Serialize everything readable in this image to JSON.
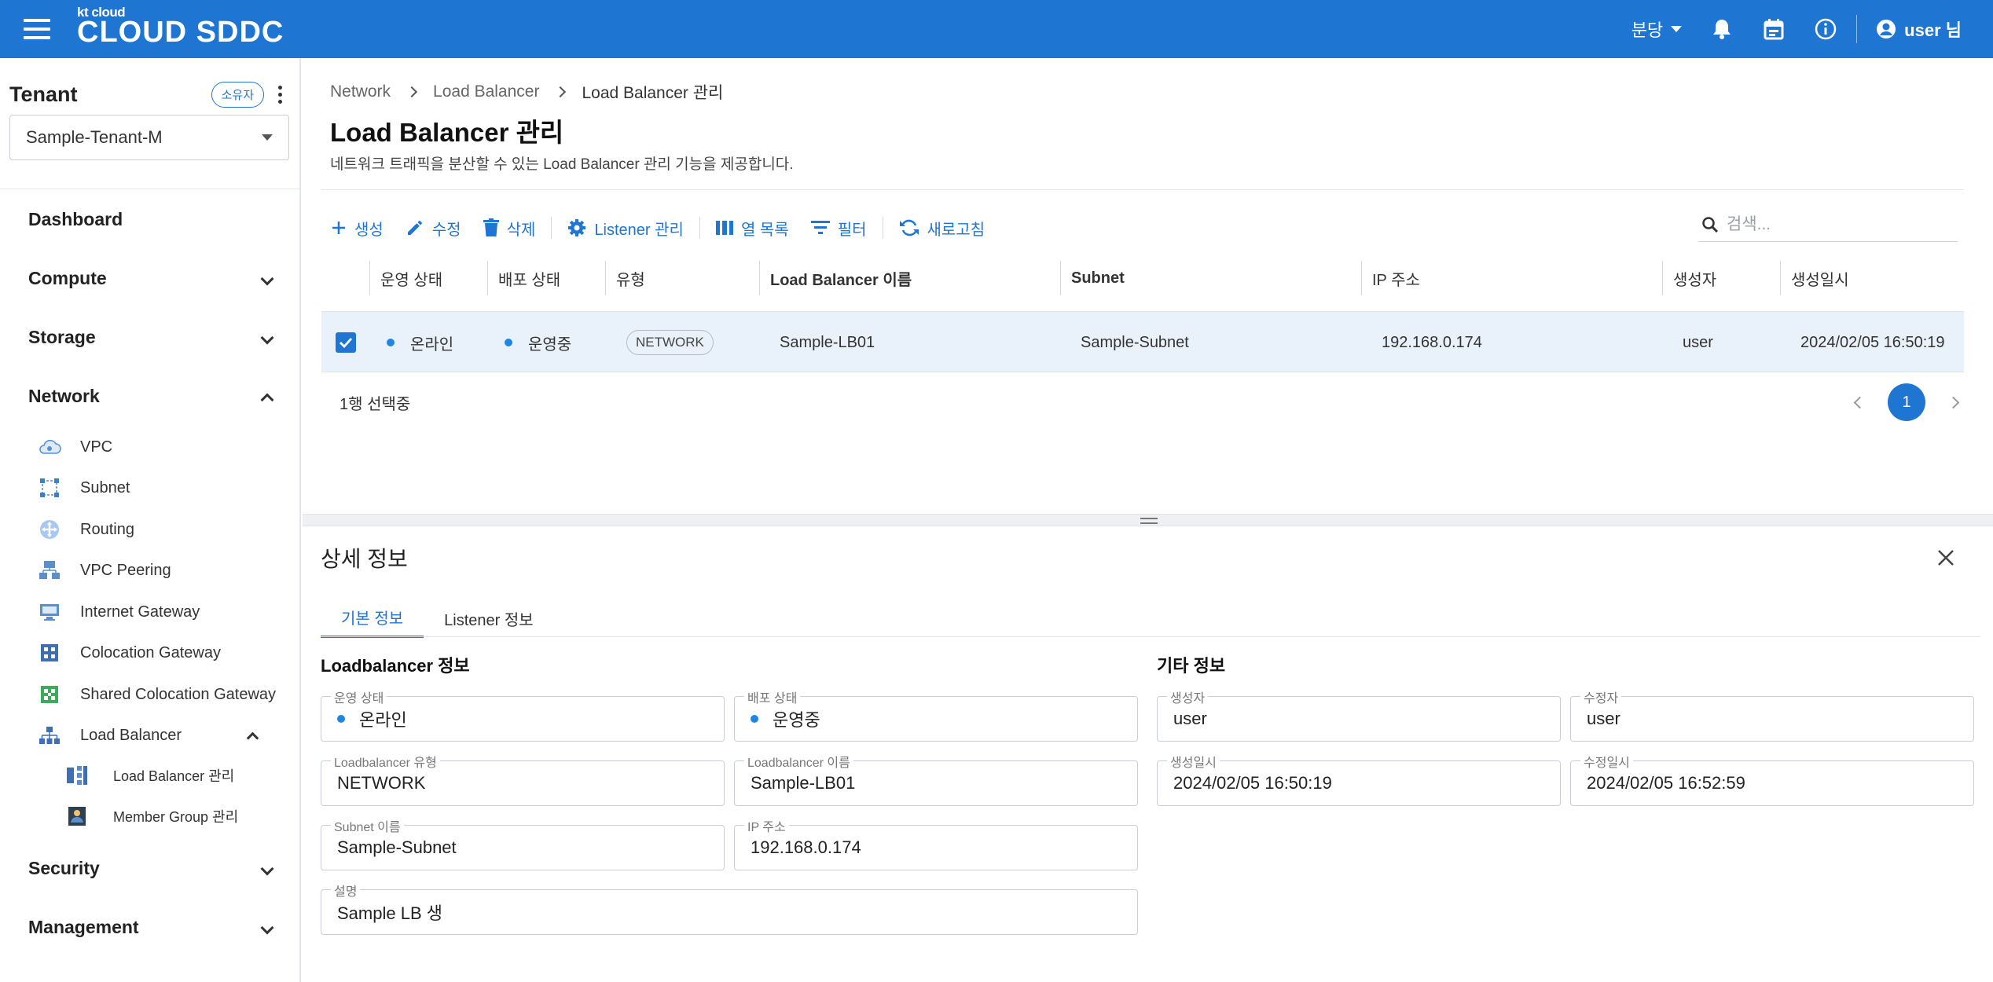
{
  "topbar": {
    "logo_small": "kt cloud",
    "logo_big": "CLOUD SDDC",
    "branch": "분당",
    "user": "user 님"
  },
  "sidebar": {
    "tenant_title": "Tenant",
    "owner_badge": "소유자",
    "tenant_value": "Sample-Tenant-M",
    "sections": {
      "dashboard": "Dashboard",
      "compute": "Compute",
      "storage": "Storage",
      "network": "Network",
      "security": "Security",
      "management": "Management"
    },
    "network_items": {
      "vpc": "VPC",
      "subnet": "Subnet",
      "routing": "Routing",
      "vpc_peering": "VPC Peering",
      "internet_gateway": "Internet Gateway",
      "colocation_gateway": "Colocation Gateway",
      "shared_colocation_gateway": "Shared Colocation Gateway",
      "load_balancer": "Load Balancer"
    },
    "lb_items": {
      "lb_manage": "Load Balancer 관리",
      "member_group": "Member Group 관리"
    }
  },
  "breadcrumb": [
    "Network",
    "Load Balancer",
    "Load Balancer 관리"
  ],
  "page": {
    "title": "Load Balancer 관리",
    "description": "네트워크 트래픽을 분산할 수 있는 Load Balancer 관리 기능을 제공합니다."
  },
  "toolbar": {
    "create": "생성",
    "edit": "수정",
    "delete": "삭제",
    "listener": "Listener 관리",
    "columns": "열 목록",
    "filter": "필터",
    "refresh": "새로고침",
    "search_placeholder": "검색..."
  },
  "table": {
    "headers": [
      "운영 상태",
      "배포 상태",
      "유형",
      "Load Balancer 이름",
      "Subnet",
      "IP 주소",
      "생성자",
      "생성일시"
    ],
    "row": {
      "op_status": "온라인",
      "deploy_status": "운영중",
      "type": "NETWORK",
      "name": "Sample-LB01",
      "subnet": "Sample-Subnet",
      "ip": "192.168.0.174",
      "creator": "user",
      "created_at": "2024/02/05 16:50:19"
    },
    "selection_text": "1행 선택중",
    "page": "1"
  },
  "detail": {
    "title": "상세 정보",
    "tabs": [
      "기본 정보",
      "Listener 정보"
    ],
    "lb_section": "Loadbalancer 정보",
    "etc_section": "기타 정보",
    "fields": {
      "op_status": {
        "label": "운영 상태",
        "value": "온라인"
      },
      "deploy_status": {
        "label": "배포 상태",
        "value": "운영중"
      },
      "lb_type": {
        "label": "Loadbalancer 유형",
        "value": "NETWORK"
      },
      "lb_name": {
        "label": "Loadbalancer 이름",
        "value": "Sample-LB01"
      },
      "subnet_name": {
        "label": "Subnet 이름",
        "value": "Sample-Subnet"
      },
      "ip": {
        "label": "IP 주소",
        "value": "192.168.0.174"
      },
      "description": {
        "label": "설명",
        "value": "Sample LB 생"
      },
      "creator": {
        "label": "생성자",
        "value": "user"
      },
      "modifier": {
        "label": "수정자",
        "value": "user"
      },
      "created_at": {
        "label": "생성일시",
        "value": "2024/02/05 16:50:19"
      },
      "modified_at": {
        "label": "수정일시",
        "value": "2024/02/05 16:52:59"
      }
    }
  },
  "colors": {
    "primary": "#1f76d2",
    "row_selected": "#e9f1fb",
    "status_dot": "#1f86e6"
  }
}
